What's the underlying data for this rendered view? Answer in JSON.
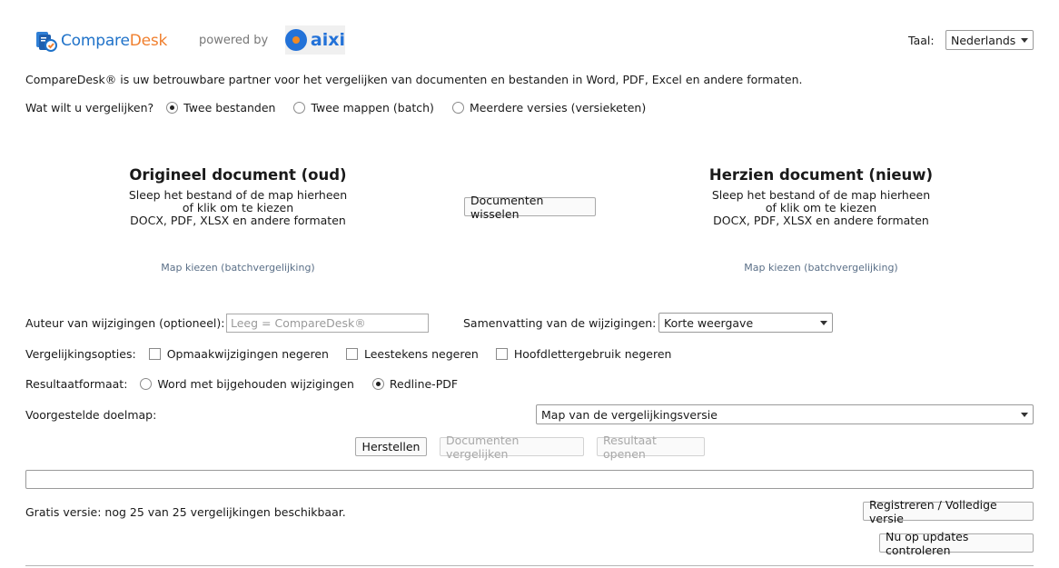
{
  "header": {
    "logo_part1": "Compare",
    "logo_part2": "Desk",
    "powered_by": "powered by",
    "partner_logo": "aixi",
    "language_label": "Taal:",
    "language_value": "Nederlands"
  },
  "intro_text": "CompareDesk® is uw betrouwbare partner voor het vergelijken van documenten en bestanden in Word, PDF, Excel en andere formaten.",
  "compare_mode": {
    "label": "Wat wilt u vergelijken?",
    "options": [
      {
        "label": "Twee bestanden",
        "checked": true
      },
      {
        "label": "Twee mappen (batch)",
        "checked": false
      },
      {
        "label": "Meerdere versies (versieketen)",
        "checked": false
      }
    ]
  },
  "original": {
    "title": "Origineel document (oud)",
    "line1": "Sleep het bestand of de map hierheen",
    "line2": "of klik om te kiezen",
    "line3": "DOCX, PDF, XLSX en andere formaten",
    "folder_link": "Map kiezen (batchvergelijking)"
  },
  "swap_button": "Documenten wisselen",
  "revised": {
    "title": "Herzien document (nieuw)",
    "line1": "Sleep het bestand of de map hierheen",
    "line2": "of klik om te kiezen",
    "line3": "DOCX, PDF, XLSX en andere formaten",
    "folder_link": "Map kiezen (batchvergelijking)"
  },
  "author": {
    "label": "Auteur van wijzigingen (optioneel):",
    "placeholder": "Leeg = CompareDesk®"
  },
  "summary": {
    "label": "Samenvatting van de wijzigingen:",
    "value": "Korte weergave"
  },
  "options": {
    "label": "Vergelijkingsopties:",
    "items": [
      {
        "label": "Opmaakwijzigingen negeren",
        "checked": false
      },
      {
        "label": "Leestekens negeren",
        "checked": false
      },
      {
        "label": "Hoofdlettergebruik negeren",
        "checked": false
      }
    ]
  },
  "result_format": {
    "label": "Resultaatformaat:",
    "options": [
      {
        "label": "Word met bijgehouden wijzigingen",
        "checked": false
      },
      {
        "label": "Redline-PDF",
        "checked": true
      }
    ]
  },
  "target_folder": {
    "label": "Voorgestelde doelmap:",
    "value": "Map van de vergelijkingsversie"
  },
  "actions": {
    "reset": "Herstellen",
    "compare": "Documenten vergelijken",
    "open_result": "Resultaat openen"
  },
  "footer": {
    "free_version": "Gratis versie: nog 25 van 25 vergelijkingen beschikbaar.",
    "register": "Registreren / Volledige versie",
    "check_updates": "Nu op updates controleren"
  },
  "colors": {
    "brand_blue": "#1f72c9",
    "brand_orange": "#f07f2e",
    "link": "#5a6f87"
  }
}
